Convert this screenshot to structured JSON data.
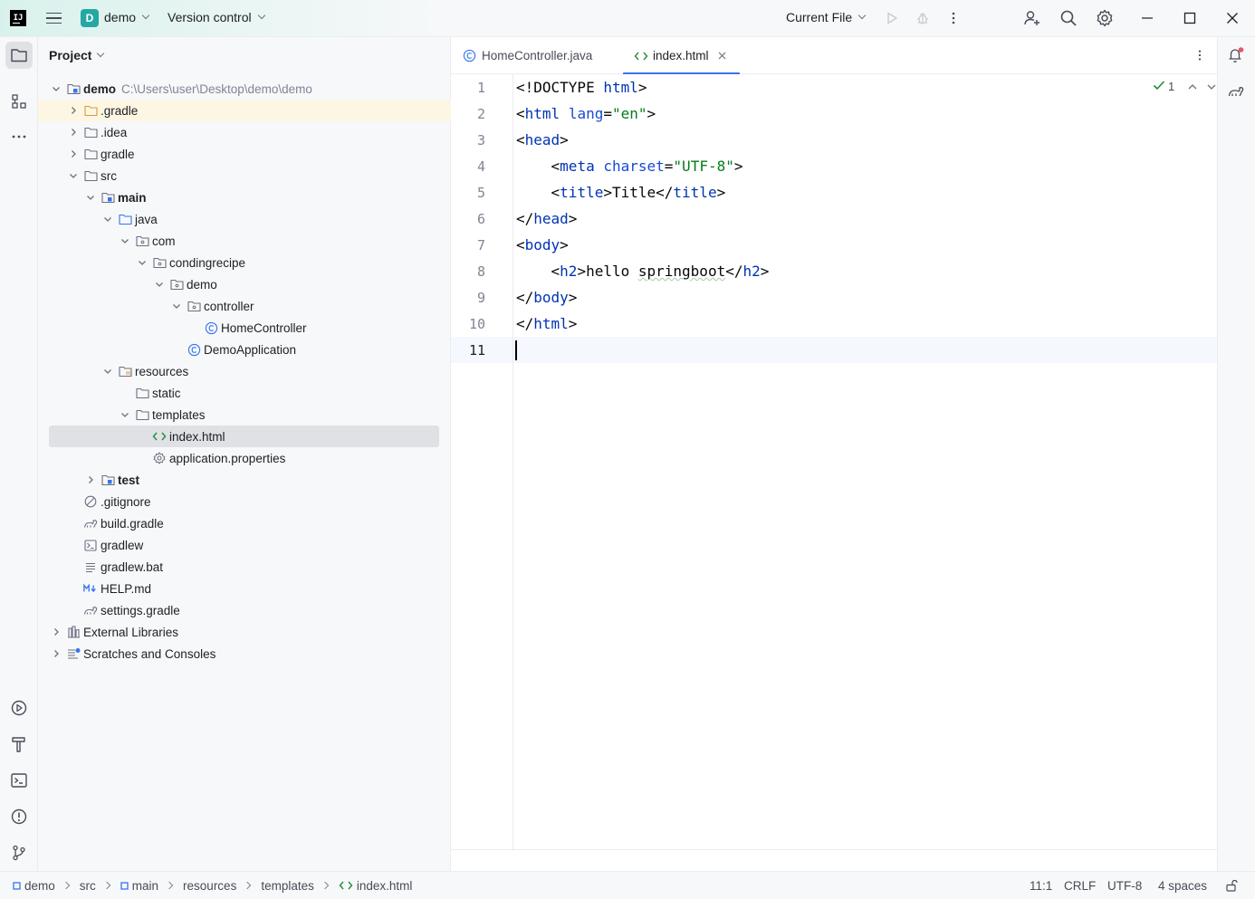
{
  "titlebar": {
    "logo_text": "IJ",
    "project_badge": "D",
    "project_name": "demo",
    "vcs_label": "Version control",
    "run_config": "Current File"
  },
  "project_panel": {
    "title": "Project",
    "tree": [
      {
        "label": "demo",
        "path": "C:\\Users\\user\\Desktop\\demo\\demo",
        "bold": true,
        "depth": 0,
        "arrow": "down",
        "icon": "module-folder"
      },
      {
        "label": ".gradle",
        "depth": 1,
        "arrow": "right",
        "icon": "folder-orange",
        "highlight": true
      },
      {
        "label": ".idea",
        "depth": 1,
        "arrow": "right",
        "icon": "folder"
      },
      {
        "label": "gradle",
        "depth": 1,
        "arrow": "right",
        "icon": "folder"
      },
      {
        "label": "src",
        "depth": 1,
        "arrow": "down",
        "icon": "folder"
      },
      {
        "label": "main",
        "bold": true,
        "depth": 2,
        "arrow": "down",
        "icon": "module-folder"
      },
      {
        "label": "java",
        "depth": 3,
        "arrow": "down",
        "icon": "source-folder"
      },
      {
        "label": "com",
        "depth": 4,
        "arrow": "down",
        "icon": "package"
      },
      {
        "label": "condingrecipe",
        "depth": 5,
        "arrow": "down",
        "icon": "package"
      },
      {
        "label": "demo",
        "depth": 6,
        "arrow": "down",
        "icon": "package"
      },
      {
        "label": "controller",
        "depth": 7,
        "arrow": "down",
        "icon": "package"
      },
      {
        "label": "HomeController",
        "depth": 8,
        "arrow": "none",
        "icon": "class"
      },
      {
        "label": "DemoApplication",
        "depth": 7,
        "arrow": "none",
        "icon": "class"
      },
      {
        "label": "resources",
        "depth": 3,
        "arrow": "down",
        "icon": "resources-folder"
      },
      {
        "label": "static",
        "depth": 4,
        "arrow": "none",
        "icon": "folder"
      },
      {
        "label": "templates",
        "depth": 4,
        "arrow": "down",
        "icon": "folder"
      },
      {
        "label": "index.html",
        "depth": 5,
        "arrow": "none",
        "icon": "html",
        "selected": true
      },
      {
        "label": "application.properties",
        "depth": 5,
        "arrow": "none",
        "icon": "properties"
      },
      {
        "label": "test",
        "bold": true,
        "depth": 2,
        "arrow": "right",
        "icon": "module-folder"
      },
      {
        "label": ".gitignore",
        "depth": 1,
        "arrow": "none",
        "icon": "gitignore"
      },
      {
        "label": "build.gradle",
        "depth": 1,
        "arrow": "none",
        "icon": "gradle"
      },
      {
        "label": "gradlew",
        "depth": 1,
        "arrow": "none",
        "icon": "shell"
      },
      {
        "label": "gradlew.bat",
        "depth": 1,
        "arrow": "none",
        "icon": "text"
      },
      {
        "label": "HELP.md",
        "depth": 1,
        "arrow": "none",
        "icon": "markdown"
      },
      {
        "label": "settings.gradle",
        "depth": 1,
        "arrow": "none",
        "icon": "gradle"
      },
      {
        "label": "External Libraries",
        "depth": 0,
        "arrow": "right",
        "icon": "libraries"
      },
      {
        "label": "Scratches and Consoles",
        "depth": 0,
        "arrow": "right",
        "icon": "scratches"
      }
    ]
  },
  "editor": {
    "tabs": [
      {
        "label": "HomeController.java",
        "icon": "class",
        "active": false
      },
      {
        "label": "index.html",
        "icon": "html",
        "active": true
      }
    ],
    "inspection_count": "1",
    "current_line": 11,
    "lines": [
      [
        {
          "t": "<!DOCTYPE ",
          "c": "tx"
        },
        {
          "t": "html",
          "c": "kw"
        },
        {
          "t": ">",
          "c": "tx"
        }
      ],
      [
        {
          "t": "<",
          "c": "tx"
        },
        {
          "t": "html",
          "c": "kw"
        },
        {
          "t": " ",
          "c": "tx"
        },
        {
          "t": "lang",
          "c": "at"
        },
        {
          "t": "=",
          "c": "tx"
        },
        {
          "t": "\"en\"",
          "c": "sv"
        },
        {
          "t": ">",
          "c": "tx"
        }
      ],
      [
        {
          "t": "<",
          "c": "tx"
        },
        {
          "t": "head",
          "c": "kw"
        },
        {
          "t": ">",
          "c": "tx"
        }
      ],
      [
        {
          "t": "    <",
          "c": "tx"
        },
        {
          "t": "meta",
          "c": "kw"
        },
        {
          "t": " ",
          "c": "tx"
        },
        {
          "t": "charset",
          "c": "at"
        },
        {
          "t": "=",
          "c": "tx"
        },
        {
          "t": "\"UTF-8\"",
          "c": "sv"
        },
        {
          "t": ">",
          "c": "tx"
        }
      ],
      [
        {
          "t": "    <",
          "c": "tx"
        },
        {
          "t": "title",
          "c": "kw"
        },
        {
          "t": ">Title</",
          "c": "tx"
        },
        {
          "t": "title",
          "c": "kw"
        },
        {
          "t": ">",
          "c": "tx"
        }
      ],
      [
        {
          "t": "</",
          "c": "tx"
        },
        {
          "t": "head",
          "c": "kw"
        },
        {
          "t": ">",
          "c": "tx"
        }
      ],
      [
        {
          "t": "<",
          "c": "tx"
        },
        {
          "t": "body",
          "c": "kw"
        },
        {
          "t": ">",
          "c": "tx"
        }
      ],
      [
        {
          "t": "    <",
          "c": "tx"
        },
        {
          "t": "h2",
          "c": "kw"
        },
        {
          "t": ">hello ",
          "c": "tx"
        },
        {
          "t": "springboot",
          "c": "squig"
        },
        {
          "t": "</",
          "c": "tx"
        },
        {
          "t": "h2",
          "c": "kw"
        },
        {
          "t": ">",
          "c": "tx"
        }
      ],
      [
        {
          "t": "</",
          "c": "tx"
        },
        {
          "t": "body",
          "c": "kw"
        },
        {
          "t": ">",
          "c": "tx"
        }
      ],
      [
        {
          "t": "</",
          "c": "tx"
        },
        {
          "t": "html",
          "c": "kw"
        },
        {
          "t": ">",
          "c": "tx"
        }
      ],
      []
    ]
  },
  "statusbar": {
    "breadcrumbs": [
      "demo",
      "src",
      "main",
      "resources",
      "templates",
      "index.html"
    ],
    "position": "11:1",
    "line_separator": "CRLF",
    "encoding": "UTF-8",
    "indent": "4 spaces"
  },
  "colors": {
    "accent": "#3574f0",
    "keyword": "#0033b3",
    "attribute": "#174ad4",
    "string": "#067d17",
    "selection": "#dfe1e5",
    "highlight_row": "#fdf6e3"
  }
}
